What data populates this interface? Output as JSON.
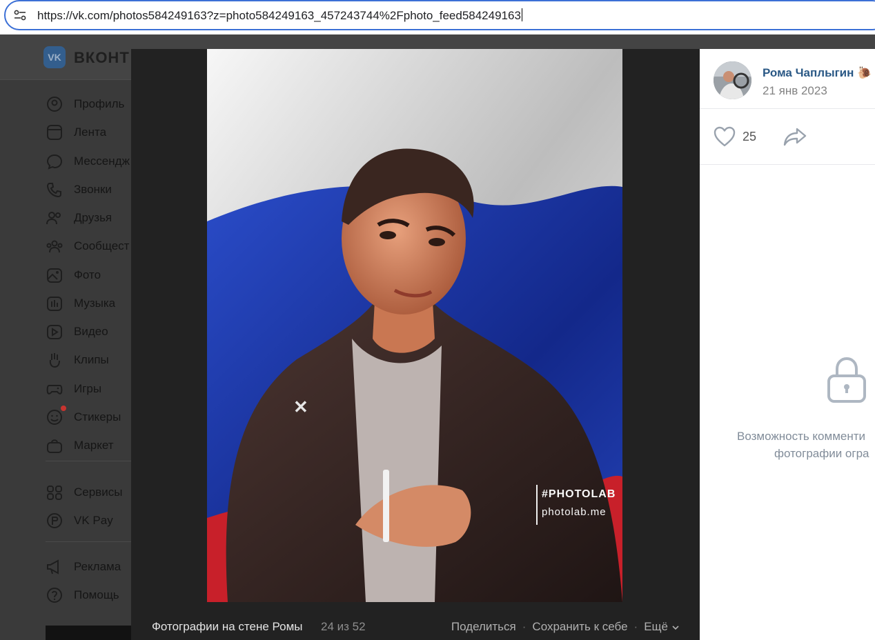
{
  "browser": {
    "url": "https://vk.com/photos584249163?z=photo584249163_457243744%2Fphoto_feed584249163"
  },
  "vk": {
    "brand": "ВКОНТ",
    "logo_text": "VK",
    "menu": [
      {
        "label": "Профиль",
        "icon": "profile-icon"
      },
      {
        "label": "Лента",
        "icon": "feed-icon"
      },
      {
        "label": "Мессендж",
        "icon": "messenger-icon"
      },
      {
        "label": "Звонки",
        "icon": "phone-icon"
      },
      {
        "label": "Друзья",
        "icon": "friends-icon"
      },
      {
        "label": "Сообщест",
        "icon": "communities-icon"
      },
      {
        "label": "Фото",
        "icon": "photo-icon"
      },
      {
        "label": "Музыка",
        "icon": "music-icon"
      },
      {
        "label": "Видео",
        "icon": "video-icon"
      },
      {
        "label": "Клипы",
        "icon": "clips-icon"
      },
      {
        "label": "Игры",
        "icon": "games-icon"
      },
      {
        "label": "Стикеры",
        "icon": "stickers-icon"
      },
      {
        "label": "Маркет",
        "icon": "market-icon"
      },
      {
        "label": "Сервисы",
        "icon": "services-icon"
      },
      {
        "label": "VK Pay",
        "icon": "vkpay-icon"
      },
      {
        "label": "Реклама",
        "icon": "ads-icon"
      },
      {
        "label": "Помощь",
        "icon": "help-icon"
      }
    ]
  },
  "viewer": {
    "watermark_tag": "#PHOTOLAB",
    "watermark_site": "photolab.me",
    "album_label": "Фотографии на стене Ромы",
    "counter": "24 из 52",
    "share_label": "Поделиться",
    "save_label": "Сохранить к себе",
    "more_label": "Ещё"
  },
  "post": {
    "author_name": "Рома Чаплыгин",
    "author_emoji": "🐌",
    "date": "21 янв 2023",
    "likes": "25",
    "comments_closed_line1": "Возможность комменти",
    "comments_closed_line2": "фотографии огра"
  },
  "colors": {
    "accent_blue": "#2a5885",
    "url_focus": "#3b6fd6",
    "flag_white": "#f2f2f2",
    "flag_blue": "#1f3fae",
    "flag_red": "#c8202a"
  }
}
